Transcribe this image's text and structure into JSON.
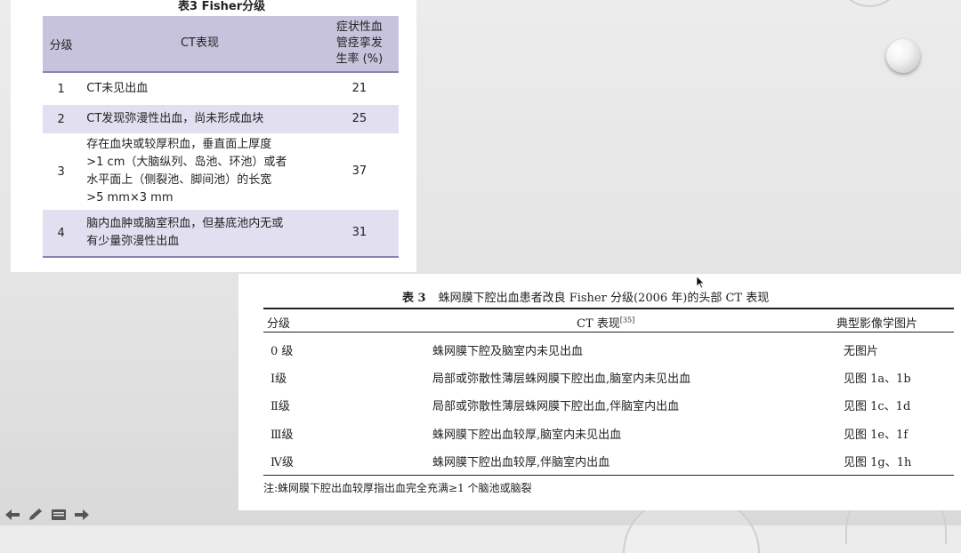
{
  "slide_table": {
    "caption": "表3  Fisher分级",
    "headers": {
      "grade": "分级",
      "ct": "CT表现",
      "rate": "症状性血管痉挛发生率 (%)"
    },
    "header_rate_lines": [
      "症状性血",
      "管痉挛发",
      "生率 (%)"
    ],
    "rows": [
      {
        "grade": "1",
        "ct_lines": [
          "CT未见出血"
        ],
        "rate": "21"
      },
      {
        "grade": "2",
        "ct_lines": [
          "CT发现弥漫性出血，尚未形成血块"
        ],
        "rate": "25"
      },
      {
        "grade": "3",
        "ct_lines": [
          "存在血块或较厚积血，垂直面上厚度",
          ">1 cm（大脑纵列、岛池、环池）或者",
          "水平面上（侧裂池、脚间池）的长宽",
          ">5 mm×3 mm"
        ],
        "rate": "37"
      },
      {
        "grade": "4",
        "ct_lines": [
          "脑内血肿或脑室积血，但基底池内无或",
          "有少量弥漫性出血"
        ],
        "rate": "31"
      }
    ]
  },
  "paper_table": {
    "caption_label": "表 3",
    "caption_text": "蛛网膜下腔出血患者改良 Fisher 分级(2006 年)的头部 CT 表现",
    "headers": {
      "grade": "分级",
      "ct": "CT 表现",
      "ct_ref": "[35]",
      "img": "典型影像学图片"
    },
    "rows": [
      {
        "grade": "0 级",
        "ct": "蛛网膜下腔及脑室内未见出血",
        "img": "无图片"
      },
      {
        "grade": "Ⅰ级",
        "ct": "局部或弥散性薄层蛛网膜下腔出血,脑室内未见出血",
        "img": "见图 1a、1b"
      },
      {
        "grade": "Ⅱ级",
        "ct": "局部或弥散性薄层蛛网膜下腔出血,伴脑室内出血",
        "img": "见图 1c、1d"
      },
      {
        "grade": "Ⅲ级",
        "ct": "蛛网膜下腔出血较厚,脑室内未见出血",
        "img": "见图 1e、1f"
      },
      {
        "grade": "Ⅳ级",
        "ct": "蛛网膜下腔出血较厚,伴脑室内出血",
        "img": "见图 1g、1h"
      }
    ],
    "note": "注:蛛网膜下腔出血较厚指出血完全充满≥1 个脑池或脑裂"
  },
  "toolbar": {
    "icons": [
      "arrow-left-icon",
      "pen-icon",
      "menu-icon",
      "arrow-right-icon"
    ]
  },
  "colors": {
    "header_bg": "#c8c3dd",
    "row_shade": "#e2dff0",
    "rule": "#8a83b0"
  }
}
